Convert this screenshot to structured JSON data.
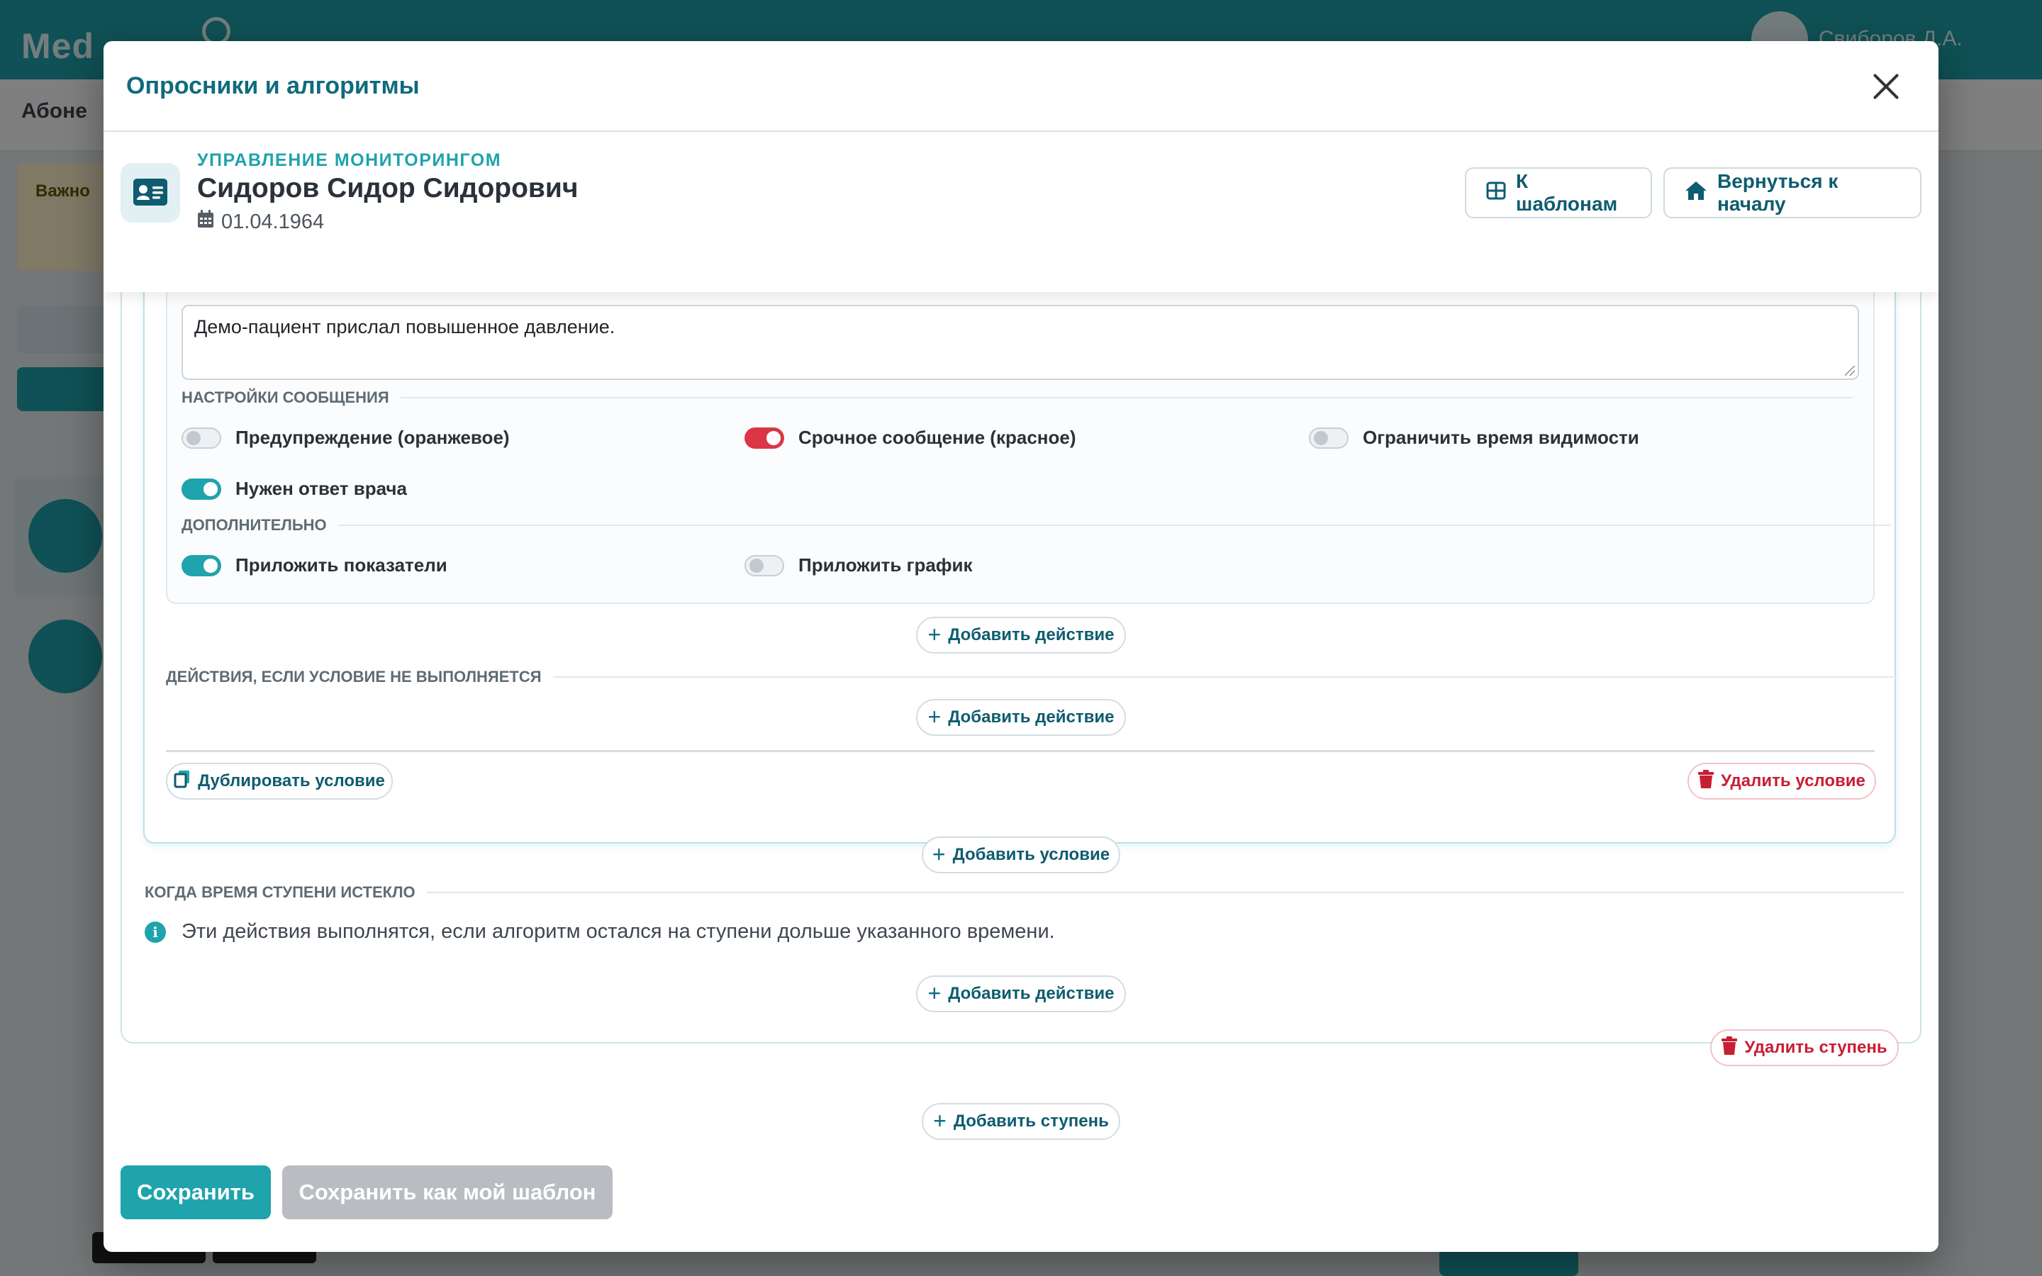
{
  "background": {
    "brand": "Med",
    "user_name": "Свиборов Д.А.",
    "page_title": "Абоне",
    "alert_title": "Важно"
  },
  "modal": {
    "title": "Опросники и алгоритмы",
    "patient": {
      "section": "Управление мониторингом",
      "name": "Сидоров Сидор Сидорович",
      "dob": "01.04.1964"
    },
    "header_buttons": {
      "templates": "К шаблонам",
      "home": "Вернуться к началу"
    },
    "message": {
      "text": "Демо-пациент прислал повышенное давление."
    },
    "settings_label": "Настройки сообщения",
    "toggles": {
      "warning": {
        "label": "Предупреждение (оранжевое)",
        "on": false
      },
      "urgent": {
        "label": "Срочное сообщение (красное)",
        "on": true
      },
      "limit_visibility": {
        "label": "Ограничить время видимости",
        "on": false
      },
      "doctor_reply": {
        "label": "Нужен ответ врача",
        "on": true
      }
    },
    "extra_label": "Дополнительно",
    "extra_toggles": {
      "attach_metrics": {
        "label": "Приложить показатели",
        "on": true
      },
      "attach_chart": {
        "label": "Приложить график",
        "on": false
      }
    },
    "add_action": "Добавить действие",
    "else_label": "Действия, если условие не выполняется",
    "duplicate_condition": "Дублировать условие",
    "delete_condition": "Удалить условие",
    "add_condition": "Добавить условие",
    "timeout_label": "Когда время ступени истекло",
    "timeout_info": "Эти действия выполнятся, если алгоритм остался на ступени дольше указанного времени.",
    "delete_step": "Удалить ступень",
    "add_step": "Добавить ступень",
    "save": "Сохранить",
    "save_template": "Сохранить как мой шаблон"
  },
  "colors": {
    "accent": "#1fa3ad",
    "title": "#0f6b7d",
    "danger": "#dc3545"
  }
}
